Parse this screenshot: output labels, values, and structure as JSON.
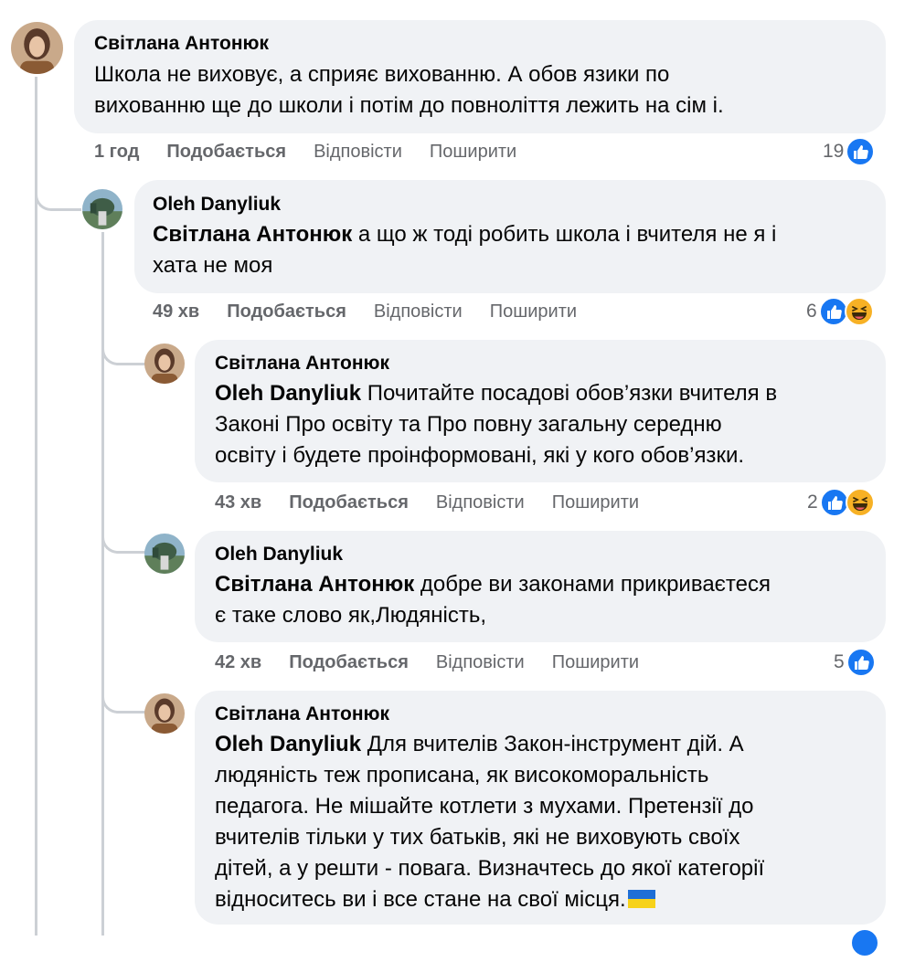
{
  "comments": [
    {
      "author": "Світлана Антонюк",
      "mention": "",
      "text_lines": [
        "Школа не виховує, а сприяє вихованню. А обов язики по",
        "вихованню ще до школи і потім до повноліття лежить на сім і."
      ],
      "time": "1 год",
      "like": "Подобається",
      "reply": "Відповісти",
      "share": "Поширити",
      "reaction_count": "19",
      "reactions": [
        "like-icon"
      ]
    },
    {
      "author": "Oleh Danyliuk",
      "mention": "Світлана Антонюк",
      "text_lines": [
        "а що ж тоді робить школа і вчителя не я і",
        "хата не моя"
      ],
      "time": "49 хв",
      "like": "Подобається",
      "reply": "Відповісти",
      "share": "Поширити",
      "reaction_count": "6",
      "reactions": [
        "like-icon",
        "haha-icon"
      ]
    },
    {
      "author": "Світлана Антонюк",
      "mention": "Oleh Danyliuk",
      "text_lines": [
        "Почитайте посадові обов’язки вчителя в",
        "Законі Про освіту та Про повну загальну середню",
        "освіту і будете проінформовані, які у кого обов’язки."
      ],
      "time": "43 хв",
      "like": "Подобається",
      "reply": "Відповісти",
      "share": "Поширити",
      "reaction_count": "2",
      "reactions": [
        "like-icon",
        "haha-icon"
      ]
    },
    {
      "author": "Oleh Danyliuk",
      "mention": "Світлана Антонюк",
      "text_lines": [
        "добре ви законами прикриваєтеся",
        "є таке слово як,Людяність,"
      ],
      "time": "42 хв",
      "like": "Подобається",
      "reply": "Відповісти",
      "share": "Поширити",
      "reaction_count": "5",
      "reactions": [
        "like-icon"
      ]
    },
    {
      "author": "Світлана Антонюк",
      "mention": "Oleh Danyliuk",
      "text_lines": [
        "Для вчителів Закон-інструмент дій. А",
        "людяність теж прописана, як високоморальність",
        "педагога. Не мішайте котлети з мухами. Претензії до",
        "вчителів тільки у тих батьків, які не виховують своїх",
        "дітей, а у решти - повага. Визначтесь до якої категорії",
        "відноситесь ви і все стане на свої місця."
      ],
      "trailing_emoji": "ukraine-flag-icon"
    }
  ],
  "colors": {
    "bubble": "#f0f2f5",
    "like_blue": "#1877f2",
    "secondary_text": "#65676b",
    "thread_line": "#ccd0d5"
  }
}
